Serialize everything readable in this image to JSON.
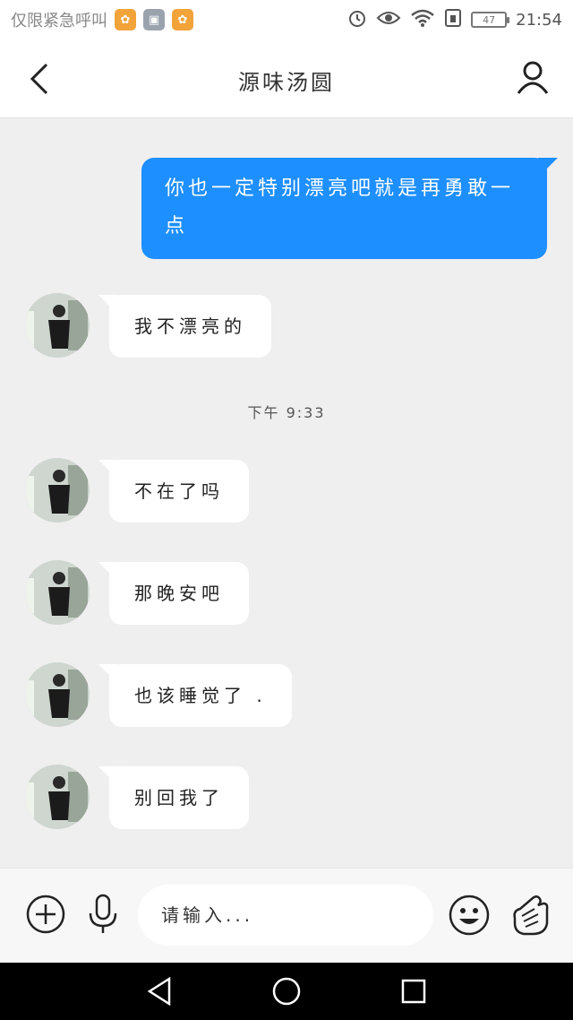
{
  "status_bar": {
    "carrier": "仅限紧急呼叫",
    "battery": "47",
    "time": "21:54",
    "icons": [
      "app-icon-orange",
      "gallery-icon",
      "app-icon-orange",
      "alarm-icon",
      "eye-icon",
      "wifi-icon",
      "sim-icon",
      "battery-icon"
    ]
  },
  "header": {
    "title": "源味汤圆",
    "back_icon": "chevron-left-icon",
    "profile_icon": "person-icon"
  },
  "messages": [
    {
      "side": "out",
      "text": "你也一定特别漂亮吧就是再勇敢一点"
    },
    {
      "side": "in",
      "text": "我不漂亮的"
    },
    {
      "side": "time",
      "text": "下午 9:33"
    },
    {
      "side": "in",
      "text": "不在了吗"
    },
    {
      "side": "in",
      "text": "那晚安吧"
    },
    {
      "side": "in",
      "text": "也该睡觉了 ."
    },
    {
      "side": "in",
      "text": "别回我了"
    }
  ],
  "input_bar": {
    "placeholder": "请输入...",
    "value": "",
    "icons": [
      "plus-circle-icon",
      "microphone-icon",
      "smiley-icon",
      "finger-heart-icon"
    ]
  },
  "nav_bar": {
    "icons": [
      "back-triangle-icon",
      "home-circle-icon",
      "recents-square-icon"
    ]
  },
  "colors": {
    "accent": "#1e8fff",
    "chat_background": "#efefef",
    "bubble_in": "#ffffff",
    "nav_bar": "#000000"
  }
}
